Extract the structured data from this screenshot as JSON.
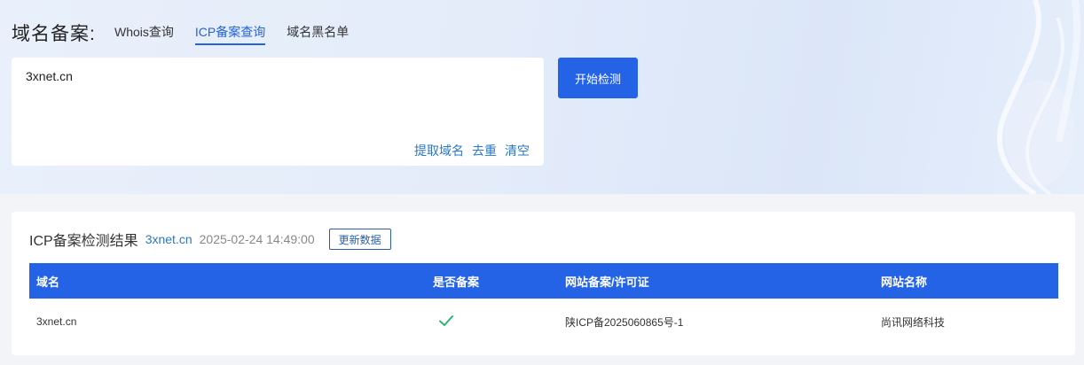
{
  "header": {
    "title": "域名备案:",
    "tabs": [
      {
        "label": "Whois查询",
        "active": false
      },
      {
        "label": "ICP备案查询",
        "active": true
      },
      {
        "label": "域名黑名单",
        "active": false
      }
    ]
  },
  "query": {
    "value": "3xnet.cn",
    "actions": [
      "提取域名",
      "去重",
      "清空"
    ],
    "start_label": "开始检测"
  },
  "result": {
    "title": "ICP备案检测结果",
    "domain": "3xnet.cn",
    "time": "2025-02-24 14:49:00",
    "refresh_label": "更新数据",
    "columns": [
      "域名",
      "是否备案",
      "网站备案/许可证",
      "网站名称"
    ],
    "rows": [
      {
        "domain": "3xnet.cn",
        "registered": "check-icon",
        "license": "陕ICP备2025060865号-1",
        "site_name": "尚讯网络科技"
      }
    ]
  },
  "colors": {
    "accent": "#2463e6",
    "link": "#2a77c6",
    "check": "#2bb673"
  }
}
